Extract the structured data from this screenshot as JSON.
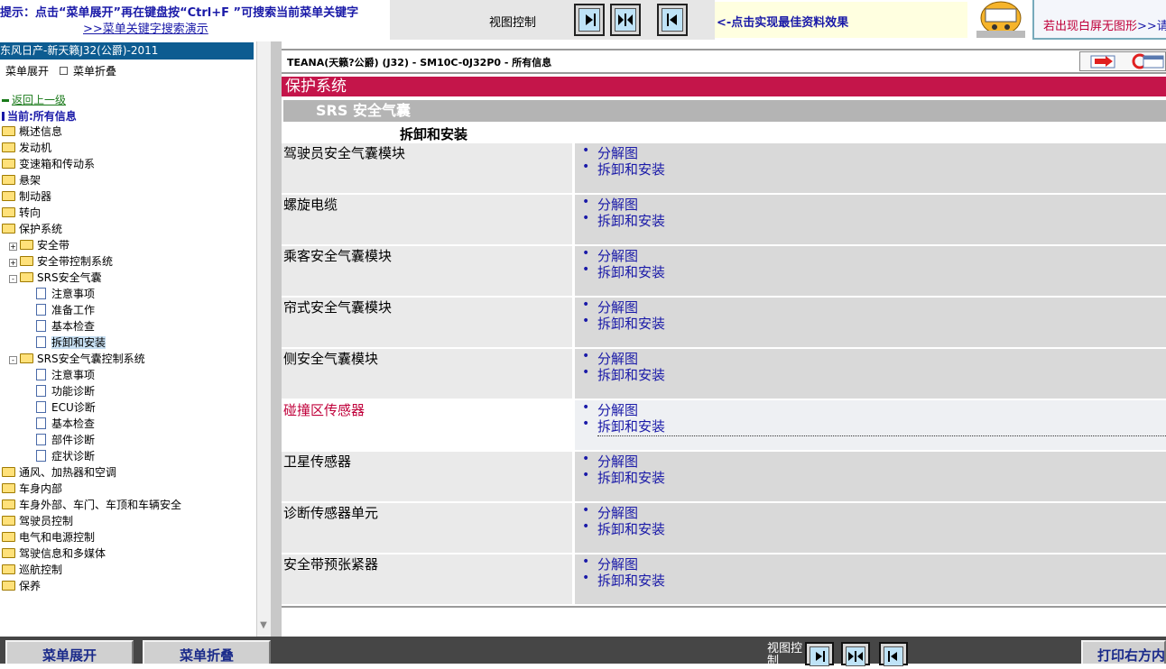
{
  "topbar": {
    "hint": "提示：点击“菜单展开”再在键盘按“Ctrl+F ”可搜索当前菜单关键字",
    "hint_link": ">>菜单关键字搜索演示",
    "view_control_label": "视图控制",
    "best_effect_link": "<-点击实现最佳资料效果",
    "white_screen_text": "若出现白屏无图形",
    "white_screen_link": ">>请下"
  },
  "left": {
    "title": "东风日产-新天籁J32(公爵)-2011",
    "expand_all": "菜单展开",
    "collapse_all": "菜单折叠",
    "back": "返回上一级",
    "current": "当前:所有信息",
    "tree": [
      {
        "label": "概述信息",
        "type": "folder",
        "level": 0
      },
      {
        "label": "发动机",
        "type": "folder",
        "level": 0
      },
      {
        "label": "变速箱和传动系",
        "type": "folder",
        "level": 0
      },
      {
        "label": "悬架",
        "type": "folder",
        "level": 0
      },
      {
        "label": "制动器",
        "type": "folder",
        "level": 0
      },
      {
        "label": "转向",
        "type": "folder",
        "level": 0
      },
      {
        "label": "保护系统",
        "type": "folder-open",
        "level": 0
      },
      {
        "label": "安全带",
        "type": "folder",
        "level": 1,
        "toggle": "+"
      },
      {
        "label": "安全带控制系统",
        "type": "folder",
        "level": 1,
        "toggle": "+"
      },
      {
        "label": "SRS安全气囊",
        "type": "folder-open",
        "level": 1,
        "toggle": "-"
      },
      {
        "label": "注意事项",
        "type": "doc",
        "level": 2
      },
      {
        "label": "准备工作",
        "type": "doc",
        "level": 2
      },
      {
        "label": "基本检查",
        "type": "doc",
        "level": 2
      },
      {
        "label": "拆卸和安装",
        "type": "doc",
        "level": 2,
        "selected": true
      },
      {
        "label": "SRS安全气囊控制系统",
        "type": "folder-open",
        "level": 1,
        "toggle": "-"
      },
      {
        "label": "注意事项",
        "type": "doc",
        "level": 2
      },
      {
        "label": "功能诊断",
        "type": "doc",
        "level": 2
      },
      {
        "label": "ECU诊断",
        "type": "doc",
        "level": 2
      },
      {
        "label": "基本检查",
        "type": "doc",
        "level": 2
      },
      {
        "label": "部件诊断",
        "type": "doc",
        "level": 2
      },
      {
        "label": "症状诊断",
        "type": "doc",
        "level": 2
      },
      {
        "label": "通风、加热器和空调",
        "type": "folder",
        "level": 0
      },
      {
        "label": "车身内部",
        "type": "folder",
        "level": 0
      },
      {
        "label": "车身外部、车门、车顶和车辆安全",
        "type": "folder",
        "level": 0
      },
      {
        "label": "驾驶员控制",
        "type": "folder",
        "level": 0
      },
      {
        "label": "电气和电源控制",
        "type": "folder",
        "level": 0
      },
      {
        "label": "驾驶信息和多媒体",
        "type": "folder",
        "level": 0
      },
      {
        "label": "巡航控制",
        "type": "folder",
        "level": 0
      },
      {
        "label": "保养",
        "type": "folder",
        "level": 0
      }
    ]
  },
  "content": {
    "breadcrumb": "TEANA(天籁?公爵) (J32) - SM10C-0J32P0 - 所有信息",
    "section": "保护系统",
    "subsection": "SRS 安全气囊",
    "table_title": "拆卸和安装",
    "rows": [
      {
        "name": "驾驶员安全气囊模块",
        "links": [
          "分解图",
          "拆卸和安装"
        ]
      },
      {
        "name": "螺旋电缆",
        "links": [
          "分解图",
          "拆卸和安装"
        ]
      },
      {
        "name": "乘客安全气囊模块",
        "links": [
          "分解图",
          "拆卸和安装"
        ]
      },
      {
        "name": "帘式安全气囊模块",
        "links": [
          "分解图",
          "拆卸和安装"
        ]
      },
      {
        "name": "侧安全气囊模块",
        "links": [
          "分解图",
          "拆卸和安装"
        ]
      },
      {
        "name": "碰撞区传感器",
        "links": [
          "分解图",
          "拆卸和安装"
        ],
        "highlight": true
      },
      {
        "name": "卫星传感器",
        "links": [
          "分解图",
          "拆卸和安装"
        ]
      },
      {
        "name": "诊断传感器单元",
        "links": [
          "分解图",
          "拆卸和安装"
        ]
      },
      {
        "name": "安全带预张紧器",
        "links": [
          "分解图",
          "拆卸和安装"
        ]
      }
    ]
  },
  "bottombar": {
    "expand_all": "菜单展开",
    "collapse_all": "菜单折叠",
    "view_control_label": "视图控制",
    "print_right": "打印右方内"
  },
  "colors": {
    "section_bar": "#c4154a",
    "link": "#1a1aa8",
    "left_title_bg": "#0d5c91"
  }
}
